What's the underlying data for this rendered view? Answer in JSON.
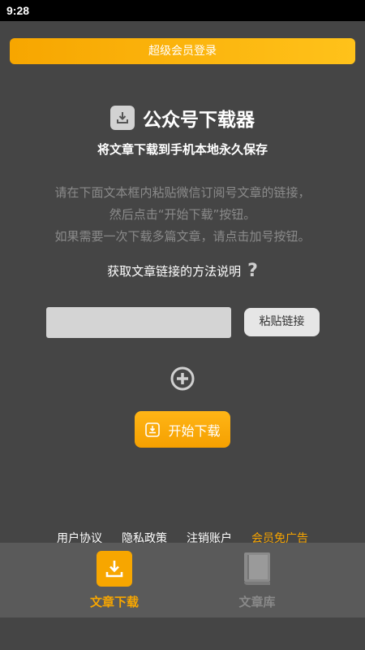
{
  "status_bar": {
    "time": "9:28"
  },
  "vip_login_label": "超级会员登录",
  "header": {
    "icon": "download-tray-icon",
    "title": "公众号下载器",
    "subtitle": "将文章下载到手机本地永久保存"
  },
  "instructions": [
    "请在下面文本框内粘贴微信订阅号文章的链接，",
    "然后点击“开始下载”按钮。",
    "如果需要一次下载多篇文章，请点击加号按钮。"
  ],
  "help": {
    "label": "获取文章链接的方法说明",
    "icon_glyph": "?"
  },
  "link_input": {
    "value": "",
    "placeholder": ""
  },
  "paste_label": "粘贴链接",
  "start_download_label": "开始下载",
  "footer": {
    "user_agreement": "用户协议",
    "privacy_policy": "隐私政策",
    "cancel_account": "注销账户",
    "vip_no_ads": "会员免广告"
  },
  "bottom_nav": [
    {
      "label": "文章下载",
      "icon": "download-icon",
      "active": true
    },
    {
      "label": "文章库",
      "icon": "book-icon",
      "active": false
    }
  ],
  "colors": {
    "background": "#454545",
    "accent": "#f7a600",
    "nav_background": "#5a5a5a",
    "muted_text": "#8a8a8a"
  }
}
